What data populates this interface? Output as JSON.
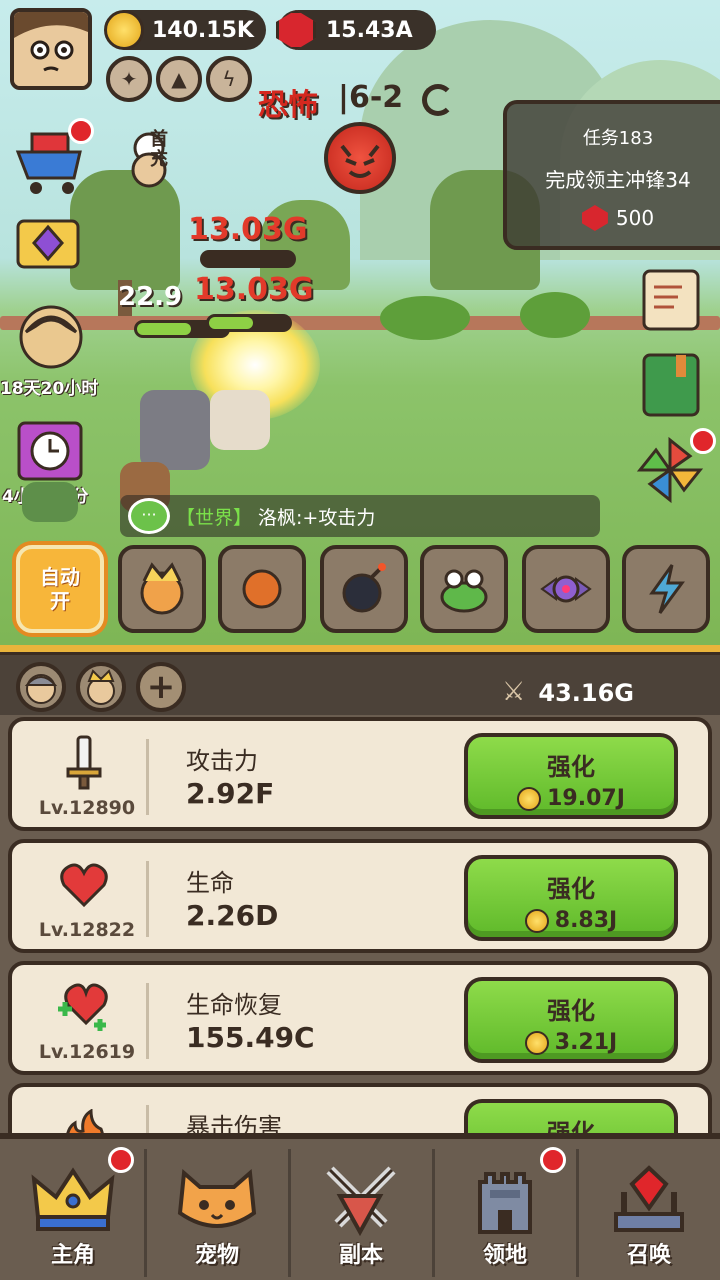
{
  "currency": {
    "gold": "140.15K",
    "gems": "15.43A"
  },
  "stage": {
    "difficulty": "恐怖",
    "level": "|6-2"
  },
  "quest": {
    "id": "任务183",
    "text": "完成领主冲锋34",
    "reward": "500"
  },
  "side_left": {
    "first_recharge_label": "首充",
    "event_timer": "18天20小时",
    "gift_timer": "4小时38分"
  },
  "battle": {
    "damage_1": "13.03G",
    "damage_2": "13.03G",
    "damage_small": "22.9",
    "enemy_hp_fraction": 0.55,
    "ally_hp_fraction": 0.6
  },
  "chat": {
    "channel": "【世界】",
    "message": "洛枫:+攻击力",
    "icon_label": "···"
  },
  "skills": {
    "auto_label_1": "自动",
    "auto_label_2": "开"
  },
  "team": {
    "add_label": "+",
    "power": "43.16G"
  },
  "stats": [
    {
      "name": "攻击力",
      "value": "2.92F",
      "level": "Lv.12890",
      "button": "强化",
      "cost": "19.07J",
      "icon": "sword-icon"
    },
    {
      "name": "生命",
      "value": "2.26D",
      "level": "Lv.12822",
      "button": "强化",
      "cost": "8.83J",
      "icon": "heart-icon"
    },
    {
      "name": "生命恢复",
      "value": "155.49C",
      "level": "Lv.12619",
      "button": "强化",
      "cost": "3.21J",
      "icon": "heart-plus-icon"
    },
    {
      "name": "暴击伤害",
      "button": "强化",
      "icon": "flame-icon"
    }
  ],
  "nav": [
    {
      "label": "主角",
      "icon": "crown-icon",
      "badge": true
    },
    {
      "label": "宠物",
      "icon": "cat-icon",
      "badge": false
    },
    {
      "label": "副本",
      "icon": "swords-icon",
      "badge": false
    },
    {
      "label": "领地",
      "icon": "castle-icon",
      "badge": true
    },
    {
      "label": "召唤",
      "icon": "summon-gem-icon",
      "badge": false
    }
  ],
  "colors": {
    "gold_bar": "#e9b43b",
    "button_green": "#6fc534",
    "badge_red": "#e0262b",
    "damage_red": "#e23a2a"
  }
}
